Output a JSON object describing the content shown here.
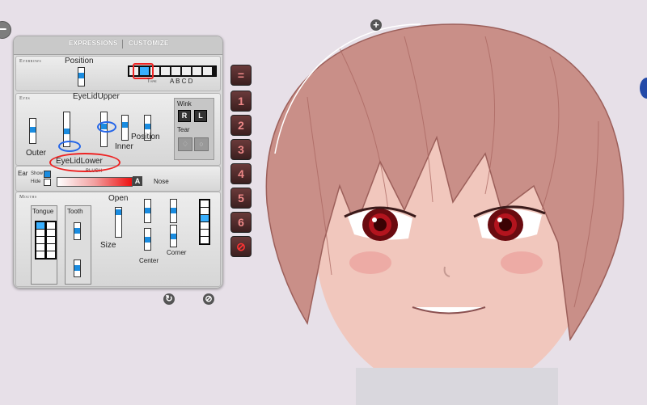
{
  "tabs": {
    "expressions": "EXPRESSIONS",
    "customize": "CUSTOMIZE"
  },
  "eyebrows": {
    "section_title": "Eyebrows",
    "position_label": "Position",
    "type_label": "Type",
    "type_letters": "A B C D"
  },
  "eyes": {
    "section_title": "Eyes",
    "upper_label": "EyeLidUpper",
    "lower_label": "EyeLidLower",
    "outer_label": "Outer",
    "inner_label": "Inner",
    "position_label": "Position",
    "wink_label": "Wink",
    "wink_r": "R",
    "wink_l": "L",
    "tear_label": "Tear"
  },
  "ear": {
    "label": "Ear",
    "show_label": "Show",
    "hide_label": "Hide",
    "blush_label": "BLUSH",
    "blush_a": "A",
    "nose_label": "Nose"
  },
  "mouth": {
    "section_title": "Mouths",
    "tongue_label": "Tongue",
    "tooth_label": "Tooth",
    "open_label": "Open",
    "size_label": "Size",
    "center_label": "Center",
    "corner_label": "Corner"
  },
  "presets": [
    "=",
    "1",
    "2",
    "3",
    "4",
    "5",
    "6",
    "⊘"
  ],
  "colors": {
    "panel": "#d6d6d6",
    "accent_blue": "#1a8ce0",
    "annotation_red": "#e22222",
    "annotation_blue": "#2566e8",
    "preset_bg": "#4b2a2a",
    "hair": "#c98f88"
  },
  "icons": {
    "collapse": "minus-icon",
    "add": "plus-icon",
    "reset": "refresh-icon",
    "clear": "no-entry-icon"
  }
}
